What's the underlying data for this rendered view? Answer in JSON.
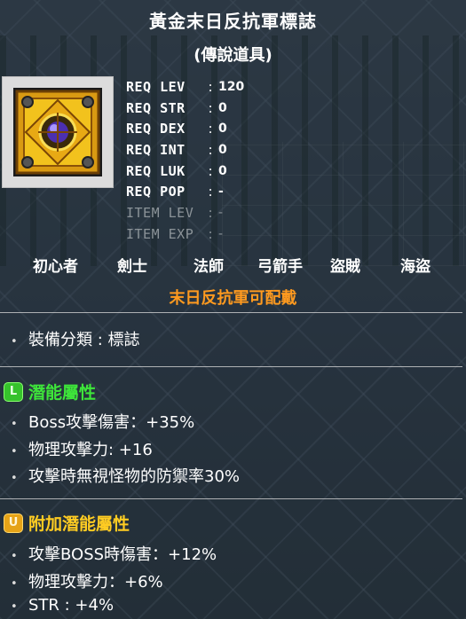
{
  "item": {
    "name": "黃金末日反抗軍標誌",
    "rarity": "(傳說道具)",
    "icon": "golden-emblem-icon"
  },
  "requirements": [
    {
      "label": "REQ LEV",
      "value": "120",
      "dim": false
    },
    {
      "label": "REQ STR",
      "value": "0",
      "dim": false
    },
    {
      "label": "REQ DEX",
      "value": "0",
      "dim": false
    },
    {
      "label": "REQ INT",
      "value": "0",
      "dim": false
    },
    {
      "label": "REQ LUK",
      "value": "0",
      "dim": false
    },
    {
      "label": "REQ POP",
      "value": "-",
      "dim": false
    },
    {
      "label": "ITEM LEV",
      "value": "-",
      "dim": true
    },
    {
      "label": "ITEM EXP",
      "value": "-",
      "dim": true
    }
  ],
  "jobs": [
    "初心者",
    "劍士",
    "法師",
    "弓箭手",
    "盜賊",
    "海盜"
  ],
  "equip_note": "末日反抗軍可配戴",
  "category_line": "裝備分類 : 標誌",
  "potential": {
    "badge": "L",
    "title": "潛能屬性",
    "title_color": "#3ee63a",
    "lines": [
      "Boss攻擊傷害：+35%",
      "物理攻擊力: +16",
      "攻擊時無視怪物的防禦率30%"
    ]
  },
  "bonus_potential": {
    "badge": "U",
    "title": "附加潛能屬性",
    "title_color": "#ffcc22",
    "lines": [
      "攻擊BOSS時傷害：+12%",
      "物理攻擊力：+6%",
      "STR : +4%"
    ]
  },
  "colors": {
    "equip_note": "#ff9a1f",
    "text": "#ffffff",
    "dim_text": "#8b9398"
  }
}
